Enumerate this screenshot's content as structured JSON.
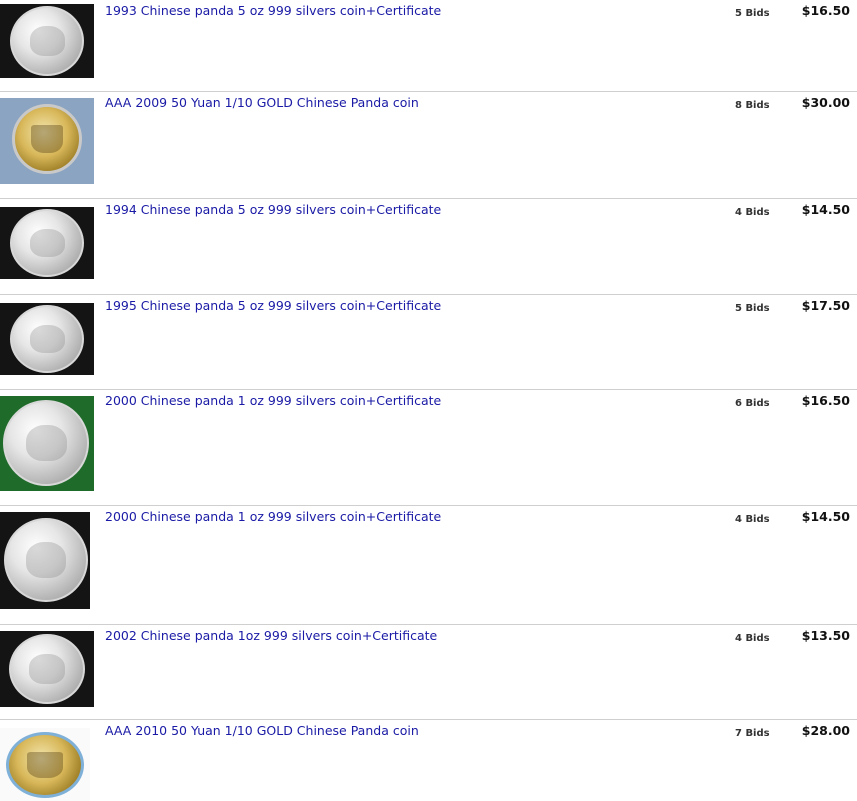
{
  "listings": [
    {
      "title": "1993 Chinese panda 5 oz 999 silvers coin+Certificate",
      "bids": "5 Bids",
      "price": "$16.50",
      "image": "silver-panda-coin"
    },
    {
      "title": "AAA 2009 50 Yuan 1/10 GOLD Chinese Panda coin",
      "bids": "8 Bids",
      "price": "$30.00",
      "image": "gold-temple-coin"
    },
    {
      "title": "1994 Chinese panda 5 oz 999 silvers coin+Certificate",
      "bids": "4 Bids",
      "price": "$14.50",
      "image": "silver-panda-coin"
    },
    {
      "title": "1995 Chinese panda 5 oz 999 silvers coin+Certificate",
      "bids": "5 Bids",
      "price": "$17.50",
      "image": "silver-panda-coin"
    },
    {
      "title": "2000 Chinese panda 1 oz 999 silvers coin+Certificate",
      "bids": "6 Bids",
      "price": "$16.50",
      "image": "silver-panda-coin"
    },
    {
      "title": "2000 Chinese panda 1 oz 999 silvers coin+Certificate",
      "bids": "4 Bids",
      "price": "$14.50",
      "image": "silver-panda-coin"
    },
    {
      "title": "2002 Chinese panda 1oz 999 silvers coin+Certificate",
      "bids": "4 Bids",
      "price": "$13.50",
      "image": "silver-panda-coin"
    },
    {
      "title": "AAA 2010 50 Yuan 1/10 GOLD Chinese Panda coin",
      "bids": "7 Bids",
      "price": "$28.00",
      "image": "gold-panda-coin"
    }
  ],
  "colors": {
    "link": "#1a1aa6",
    "divider": "#cfcfcf",
    "price": "#111111"
  }
}
